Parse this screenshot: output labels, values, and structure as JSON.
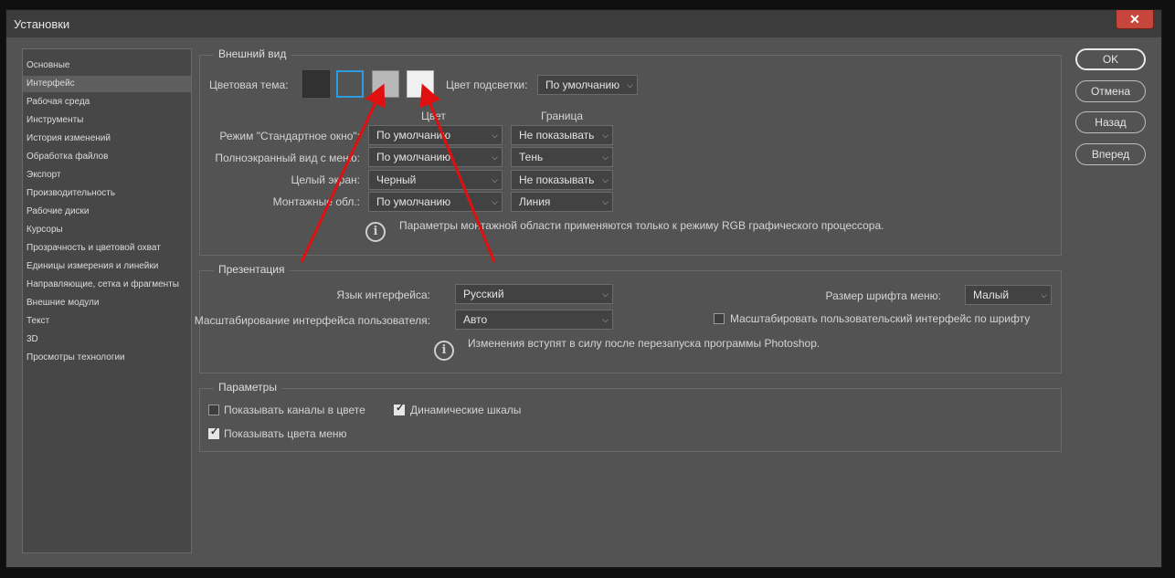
{
  "window": {
    "title": "Установки",
    "close_glyph": "✕"
  },
  "sidebar": {
    "items": [
      "Основные",
      "Интерфейс",
      "Рабочая среда",
      "Инструменты",
      "История изменений",
      "Обработка файлов",
      "Экспорт",
      "Производительность",
      "Рабочие диски",
      "Курсоры",
      "Прозрачность и цветовой охват",
      "Единицы измерения и линейки",
      "Направляющие, сетка и фрагменты",
      "Внешние модули",
      "Текст",
      "3D",
      "Просмотры технологии"
    ],
    "selected": "Интерфейс"
  },
  "appearance": {
    "title": "Внешний вид",
    "color_theme_label": "Цветовая тема:",
    "themes": [
      {
        "name": "dark",
        "color": "#323232",
        "selected": false
      },
      {
        "name": "medium-dark",
        "color": "#535353",
        "selected": true
      },
      {
        "name": "medium-light",
        "color": "#b8b8b8",
        "selected": false
      },
      {
        "name": "light",
        "color": "#f0f0f0",
        "selected": false
      }
    ],
    "selection_color": "#2b9be4",
    "highlight_label": "Цвет подсветки:",
    "highlight_value": "По умолчанию",
    "col_color": "Цвет",
    "col_border": "Граница",
    "rows": [
      {
        "label": "Режим \"Стандартное окно\":",
        "color": "По умолчанию",
        "border": "Не показывать"
      },
      {
        "label": "Полноэкранный вид с меню:",
        "color": "По умолчанию",
        "border": "Тень"
      },
      {
        "label": "Целый экран:",
        "color": "Черный",
        "border": "Не показывать"
      },
      {
        "label": "Монтажные обл.:",
        "color": "По умолчанию",
        "border": "Линия"
      }
    ],
    "info_text": "Параметры монтажной области применяются только к режиму RGB графического процессора."
  },
  "presentation": {
    "title": "Презентация",
    "ui_language_label": "Язык интерфейса:",
    "ui_language_value": "Русский",
    "ui_scaling_label": "Масштабирование интерфейса пользователя:",
    "ui_scaling_value": "Авто",
    "menu_font_size_label": "Размер шрифта меню:",
    "menu_font_size_value": "Малый",
    "scale_to_font_label": "Масштабировать пользовательский интерфейс по шрифту",
    "scale_to_font_checked": false,
    "info_text": "Изменения вступят в силу после перезапуска программы Photoshop."
  },
  "options": {
    "title": "Параметры",
    "show_channels_label": "Показывать каналы в цвете",
    "show_channels_checked": false,
    "dynamic_sliders_label": "Динамические шкалы",
    "dynamic_sliders_checked": true,
    "show_menu_colors_label": "Показывать цвета меню",
    "show_menu_colors_checked": true
  },
  "buttons": {
    "ok": "OK",
    "cancel": "Отмена",
    "back": "Назад",
    "next": "Вперед"
  },
  "annotation_color": "#e01010",
  "icons": {
    "dropdown": "chevron-down-icon",
    "info": "info-icon",
    "check": "checkmark-icon"
  },
  "glyphs": {
    "chevron": "⌵",
    "info": "i",
    "check": "✓"
  }
}
